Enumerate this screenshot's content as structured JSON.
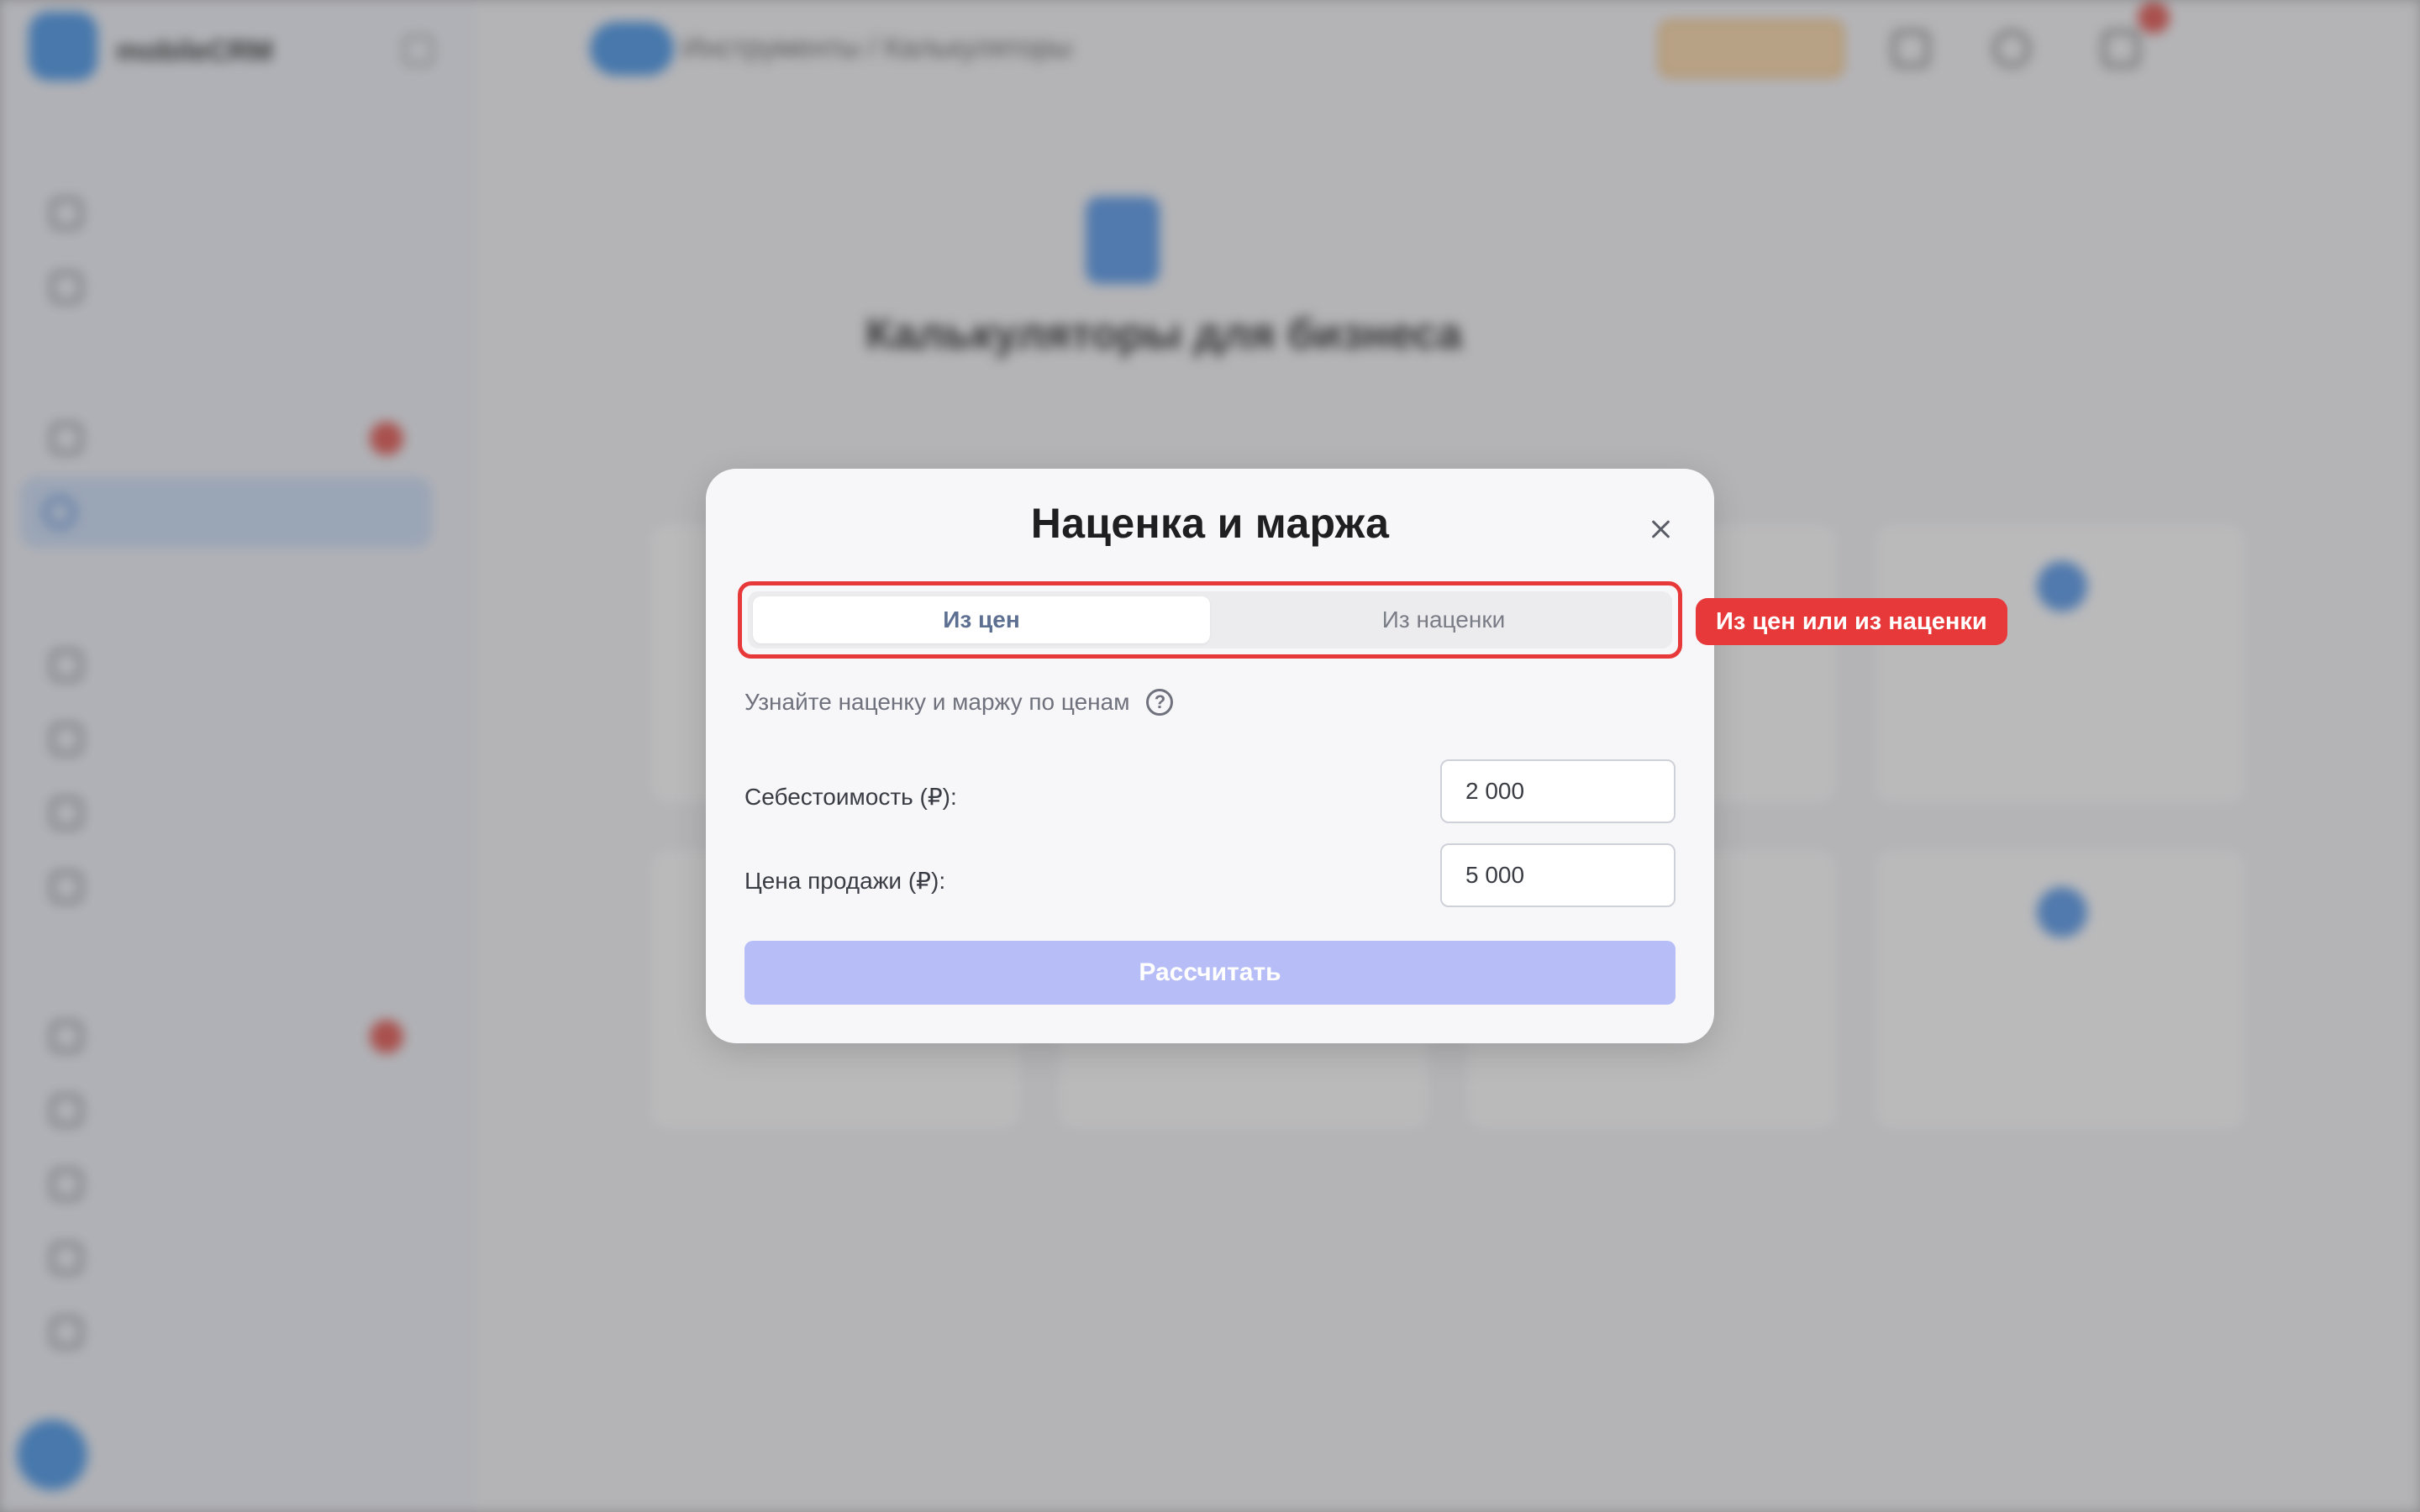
{
  "background": {
    "sidebar": {
      "brand": "mobileCRM",
      "groups": [
        "",
        "",
        "",
        ""
      ],
      "items": [
        {
          "label": ""
        },
        {
          "label": ""
        },
        {
          "label": ""
        },
        {
          "label": ""
        },
        {
          "label": ""
        },
        {
          "label": ""
        },
        {
          "label": ""
        },
        {
          "label": ""
        },
        {
          "label": ""
        },
        {
          "label": ""
        },
        {
          "label": ""
        },
        {
          "label": ""
        },
        {
          "label": ""
        }
      ],
      "user_name": ""
    },
    "topbar": {
      "breadcrumb": "Инструменты / Калькуляторы",
      "user_label": ""
    },
    "main": {
      "title": "Калькуляторы для бизнеса",
      "subtitle": "",
      "link": ""
    }
  },
  "modal": {
    "title": "Наценка и маржа",
    "close_icon": "close-icon",
    "tabs": [
      {
        "label": "Из цен",
        "active": true
      },
      {
        "label": "Из наценки",
        "active": false
      }
    ],
    "hint": "Узнайте наценку и маржу по ценам",
    "help_icon_glyph": "?",
    "fields": [
      {
        "label": "Себестоимость (₽):",
        "value": "2 000"
      },
      {
        "label": "Цена продажи (₽):",
        "value": "5 000"
      }
    ],
    "submit_label": "Рассчитать"
  },
  "annotation": {
    "callout_text": "Из цен или из наценки",
    "color": "#e8393a"
  },
  "colors": {
    "primary_button_disabled": "#b7bef7",
    "active_tab_text": "#5e7092",
    "sidebar_active": "#c9dbf6"
  }
}
